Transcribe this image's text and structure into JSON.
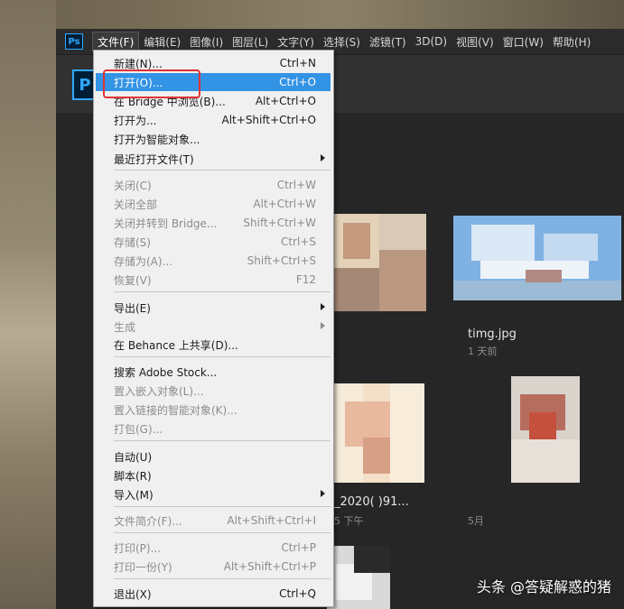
{
  "menubar": {
    "items": [
      "文件(F)",
      "编辑(E)",
      "图像(I)",
      "图层(L)",
      "文字(Y)",
      "选择(S)",
      "滤镜(T)",
      "3D(D)",
      "视图(V)",
      "窗口(W)",
      "帮助(H)"
    ]
  },
  "logo": {
    "small": "Ps",
    "big": "P"
  },
  "dropdown": {
    "new": {
      "label": "新建(N)...",
      "shortcut": "Ctrl+N"
    },
    "open": {
      "label": "打开(O)...",
      "shortcut": "Ctrl+O"
    },
    "bridge": {
      "label": "在 Bridge 中浏览(B)...",
      "shortcut": "Alt+Ctrl+O"
    },
    "open_as": {
      "label": "打开为...",
      "shortcut": "Alt+Shift+Ctrl+O"
    },
    "open_smart": {
      "label": "打开为智能对象..."
    },
    "recent": {
      "label": "最近打开文件(T)"
    },
    "close": {
      "label": "关闭(C)",
      "shortcut": "Ctrl+W"
    },
    "close_all": {
      "label": "关闭全部",
      "shortcut": "Alt+Ctrl+W"
    },
    "close_bridge": {
      "label": "关闭并转到 Bridge...",
      "shortcut": "Shift+Ctrl+W"
    },
    "save": {
      "label": "存储(S)",
      "shortcut": "Ctrl+S"
    },
    "save_as": {
      "label": "存储为(A)...",
      "shortcut": "Shift+Ctrl+S"
    },
    "revert": {
      "label": "恢复(V)",
      "shortcut": "F12"
    },
    "export": {
      "label": "导出(E)"
    },
    "generate": {
      "label": "生成"
    },
    "behance": {
      "label": "在 Behance 上共享(D)..."
    },
    "stock": {
      "label": "搜索 Adobe Stock..."
    },
    "place_embed": {
      "label": "置入嵌入对象(L)..."
    },
    "place_link": {
      "label": "置入链接的智能对象(K)..."
    },
    "package": {
      "label": "打包(G)..."
    },
    "automate": {
      "label": "自动(U)"
    },
    "scripts": {
      "label": "脚本(R)"
    },
    "import": {
      "label": "导入(M)"
    },
    "file_info": {
      "label": "文件简介(F)...",
      "shortcut": "Alt+Shift+Ctrl+I"
    },
    "print": {
      "label": "打印(P)...",
      "shortcut": "Ctrl+P"
    },
    "print_one": {
      "label": "打印一份(Y)",
      "shortcut": "Alt+Shift+Ctrl+P"
    },
    "exit": {
      "label": "退出(X)",
      "shortcut": "Ctrl+Q"
    }
  },
  "recent_files": [
    {
      "name": "timg.jpg",
      "time": "1 天前"
    },
    {
      "name": "_2020(   )91...",
      "time": "5 下午"
    },
    {
      "name": "",
      "time": "5月"
    }
  ],
  "watermark": "头条 @答疑解惑的猪"
}
